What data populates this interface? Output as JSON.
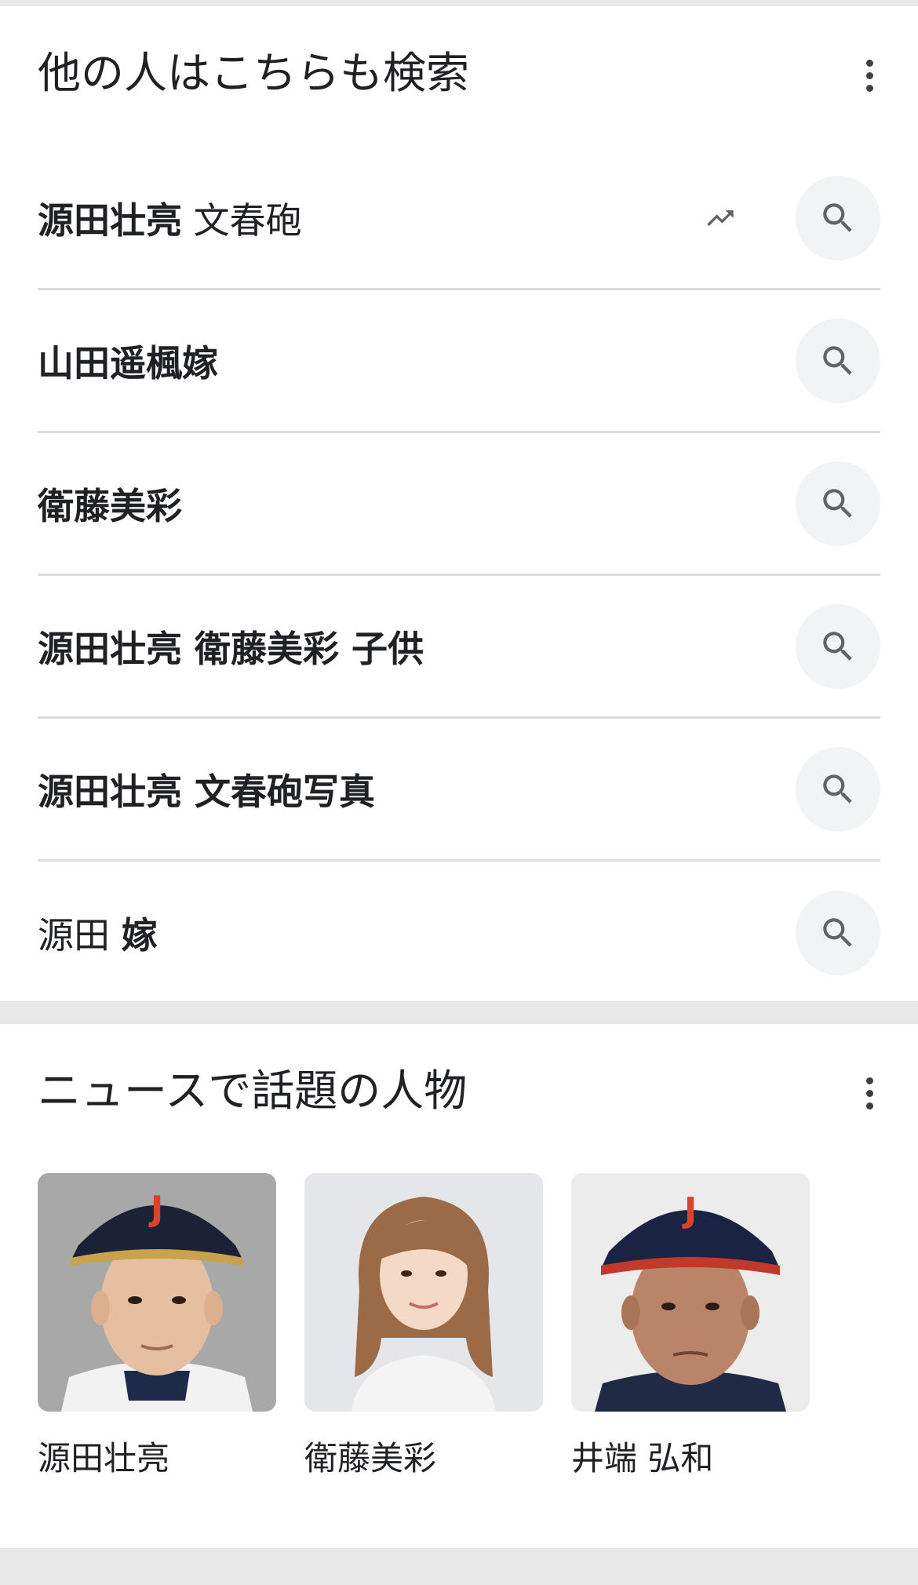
{
  "related": {
    "title": "他の人はこちらも検索",
    "items": [
      {
        "bold": "源田壮亮",
        "rest": " 文春砲",
        "trending": true
      },
      {
        "bold": "山田遥楓嫁",
        "rest": "",
        "trending": false
      },
      {
        "bold": "衛藤美彩",
        "rest": "",
        "trending": false
      },
      {
        "bold": "源田壮亮 衛藤美彩 子供",
        "rest": "",
        "trending": false
      },
      {
        "bold": "源田壮亮 文春砲写真",
        "rest": "",
        "trending": false
      },
      {
        "pre": "源田 ",
        "bold": "嫁",
        "rest": "",
        "trending": false
      }
    ]
  },
  "people": {
    "title": "ニュースで話題の人物",
    "items": [
      {
        "name": "源田壮亮"
      },
      {
        "name": "衛藤美彩"
      },
      {
        "name": "井端 弘和"
      }
    ]
  },
  "colors": {
    "card": "#ffffff",
    "page_bg": "#e8e8e8",
    "divider": "#dadce0",
    "search_btn_bg": "#f1f3f4",
    "icon": "#5f6368"
  },
  "icons": {
    "trending": "trending-up-icon",
    "search": "search-icon",
    "more": "more-vert-icon"
  }
}
